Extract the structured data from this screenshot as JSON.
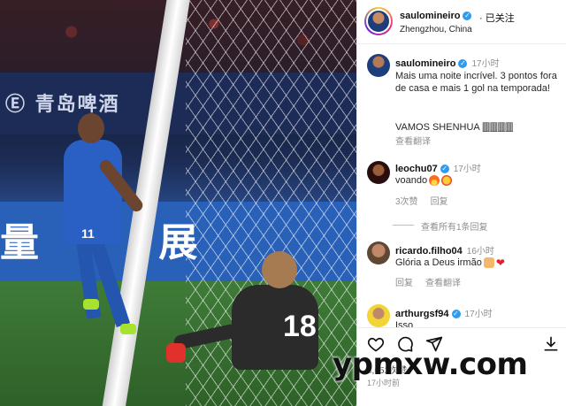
{
  "header": {
    "username": "saulomineiro",
    "follow_state": "· 已关注",
    "location": "Zhengzhou, China"
  },
  "photo": {
    "banner_top_text": "Ⓔ 青岛啤酒",
    "banner_bottom_text": "量 展",
    "striker_number": "11",
    "keeper_number": "18"
  },
  "caption": {
    "username": "saulomineiro",
    "time": "17小时",
    "text": "Mais uma noite incrível. 3 pontos fora de casa e mais 1 gol na temporada!",
    "text2": "VAMOS SHENHUA 🀫🀫🀫🀫",
    "translate": "查看翻译"
  },
  "comments": [
    {
      "username": "leochu07",
      "time": "17小时",
      "text": "voando",
      "meta": [
        "3次赞",
        "回复"
      ]
    },
    {
      "username": "ricardo.filho04",
      "time": "16小时",
      "text": "Glória a Deus irmão",
      "meta": [
        "回复",
        "查看翻译"
      ]
    },
    {
      "username": "arthurgsf94",
      "time": "17小时",
      "text": "Isso",
      "meta": []
    }
  ],
  "view_all_replies": "查看所有1条回复",
  "likes_text": "3,052次赞",
  "ago_text": "17小时前",
  "icons": [
    "heart-icon",
    "comment-icon",
    "share-icon",
    "save-icon",
    "verified-icon"
  ],
  "watermark": "ypmxw.com",
  "colors": {
    "verified": "#2d9bf0",
    "meta_gray": "#8e8e8e",
    "text": "#262626"
  }
}
